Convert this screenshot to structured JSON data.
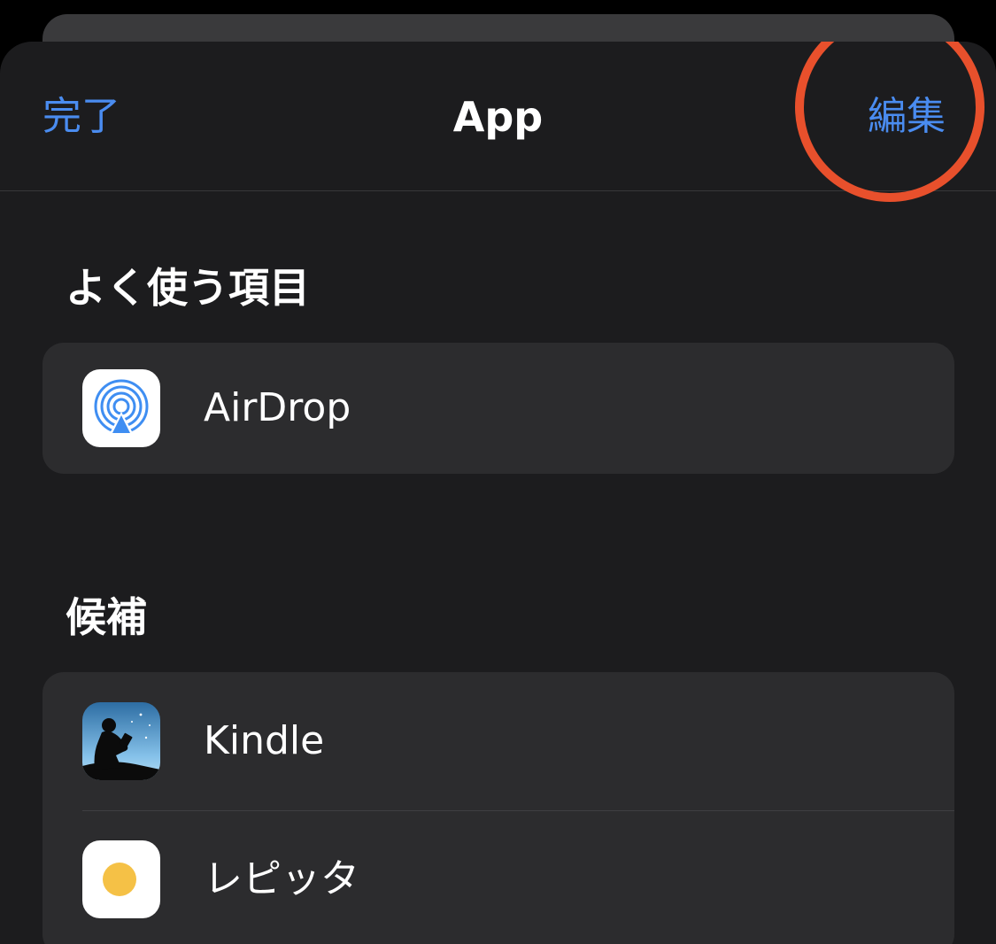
{
  "nav": {
    "done_label": "完了",
    "title": "App",
    "edit_label": "編集"
  },
  "sections": {
    "favorites": {
      "header": "よく使う項目",
      "items": [
        {
          "label": "AirDrop",
          "icon": "airdrop-icon"
        }
      ]
    },
    "suggestions": {
      "header": "候補",
      "items": [
        {
          "label": "Kindle",
          "icon": "kindle-icon"
        },
        {
          "label": "レピッタ",
          "icon": "repitta-icon"
        }
      ]
    }
  },
  "colors": {
    "accent": "#4a8cf0",
    "highlight_ring": "#e8502c",
    "sheet_background": "#1c1c1e",
    "group_background": "#2c2c2e",
    "airdrop_blue": "#3f8ef2",
    "repitta_yellow": "#f5c146"
  }
}
